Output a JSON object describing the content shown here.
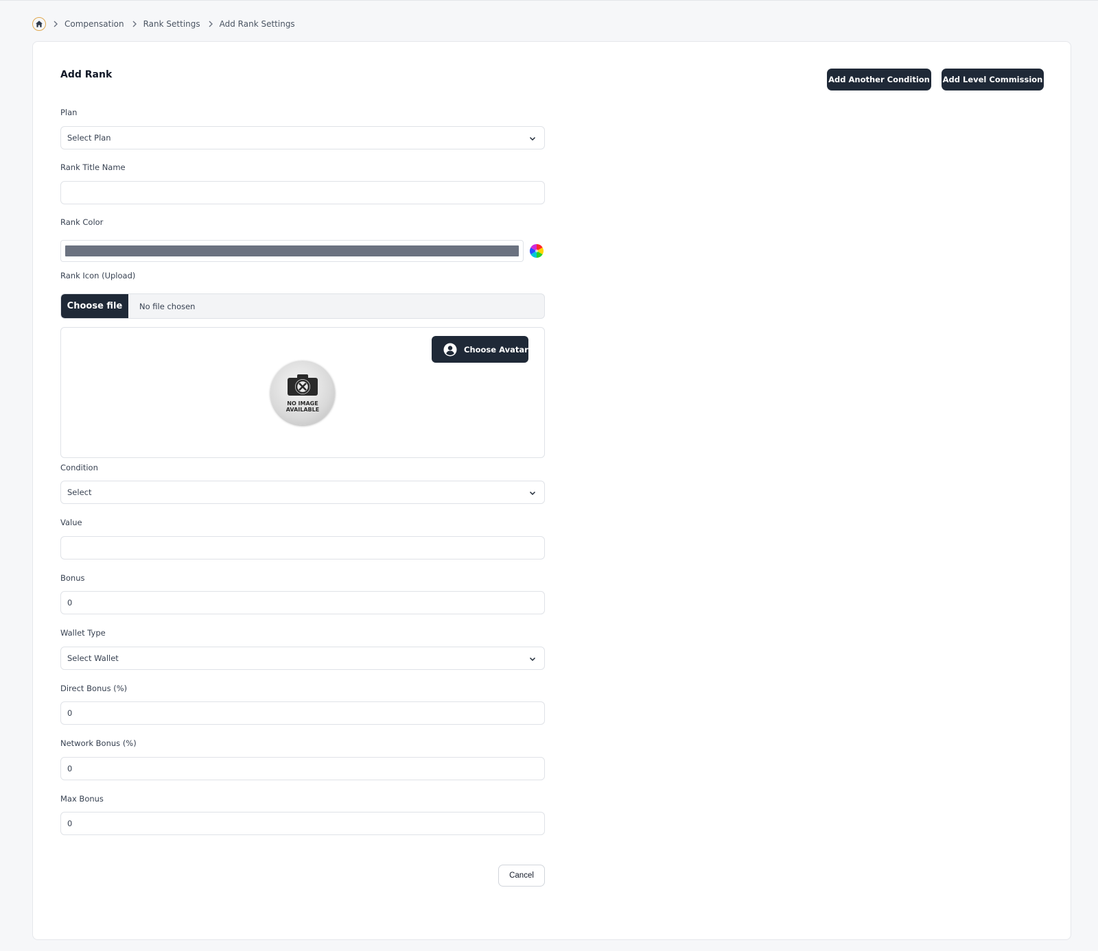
{
  "breadcrumb": {
    "items": [
      "Compensation",
      "Rank Settings",
      "Add Rank Settings"
    ]
  },
  "card": {
    "title": "Add Rank",
    "add_condition_label": "Add Another Condition",
    "add_level_commission_label": "Add Level Commission"
  },
  "form": {
    "plan": {
      "label": "Plan",
      "value": "Select Plan"
    },
    "rank_title": {
      "label": "Rank Title Name",
      "value": ""
    },
    "rank_color": {
      "label": "Rank Color",
      "value": "#6b7280"
    },
    "rank_icon": {
      "label": "Rank Icon (Upload)",
      "button": "Choose file",
      "status": "No file chosen",
      "avatar_button": "Choose Avatar",
      "placeholder_line1": "NO IMAGE",
      "placeholder_line2": "AVAILABLE"
    },
    "condition": {
      "label": "Condition",
      "value": "Select"
    },
    "value": {
      "label": "Value",
      "value": ""
    },
    "bonus": {
      "label": "Bonus",
      "value": "0"
    },
    "wallet_type": {
      "label": "Wallet Type",
      "value": "Select Wallet"
    },
    "direct_bonus": {
      "label": "Direct Bonus (%)",
      "value": "0"
    },
    "network_bonus": {
      "label": "Network Bonus (%)",
      "value": "0"
    },
    "max_bonus": {
      "label": "Max Bonus",
      "value": "0"
    },
    "cancel_label": "Cancel"
  },
  "colors": {
    "primary_button": "#1f2937",
    "home_icon_ring": "#e0a84f",
    "page_background": "#f6f7f9"
  },
  "icons": {
    "home": "home-icon",
    "separator": "chevron-right-icon",
    "dropdown": "chevron-down-icon",
    "color_picker": "color-wheel-icon",
    "avatar": "user-circle-icon",
    "no_image": "camera-off-icon"
  }
}
